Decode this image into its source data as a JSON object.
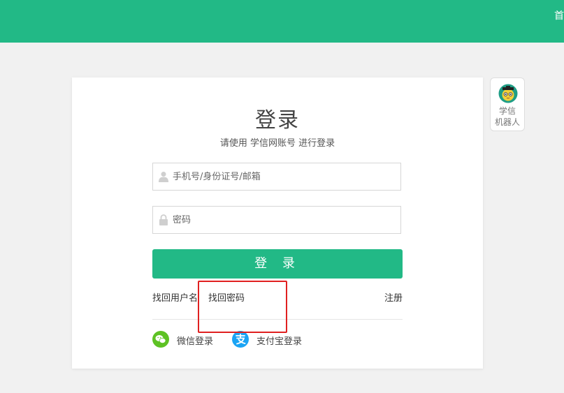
{
  "header": {
    "nav_home": "首"
  },
  "login": {
    "title": "登录",
    "subtitle": "请使用 学信网账号 进行登录",
    "username_placeholder": "手机号/身份证号/邮箱",
    "password_placeholder": "密码",
    "button_label": "登 录",
    "find_username": "找回用户名",
    "find_password": "找回密码",
    "register": "注册",
    "wechat_login": "微信登录",
    "alipay_login": "支付宝登录"
  },
  "robot": {
    "line1": "学信",
    "line2": "机器人"
  },
  "colors": {
    "brand": "#22b986",
    "highlight": "#e02020",
    "wechat": "#5ec224",
    "alipay": "#1ba4f4"
  },
  "icons": [
    "user-icon",
    "lock-icon",
    "wechat-icon",
    "alipay-icon",
    "robot-avatar-icon"
  ]
}
